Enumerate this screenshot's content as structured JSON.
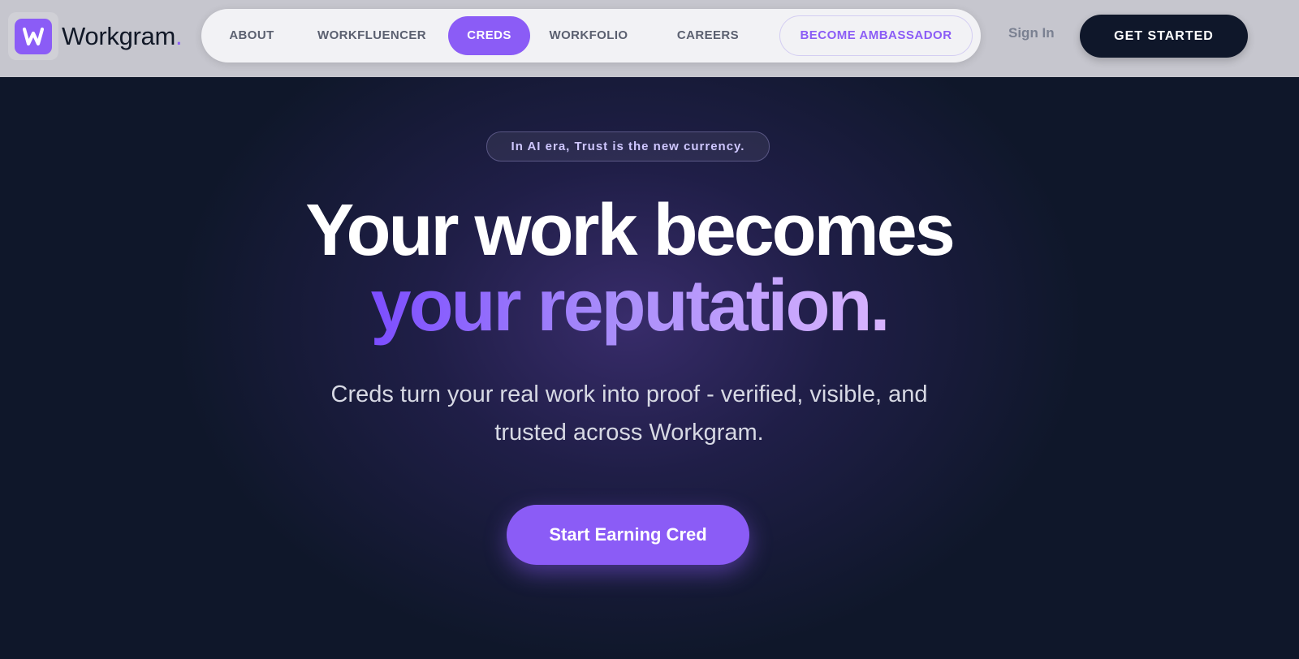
{
  "brand": {
    "name": "Workgram",
    "dot": ".",
    "logo_icon": "workgram-w-logo",
    "accent_color": "#8b5cf6"
  },
  "nav": {
    "items": [
      {
        "label": "ABOUT",
        "active": false
      },
      {
        "label": "WORKFLUENCER",
        "active": false
      },
      {
        "label": "CREDS",
        "active": true
      },
      {
        "label": "WORKFOLIO",
        "active": false
      },
      {
        "label": "CAREERS",
        "active": false
      }
    ],
    "ambassador_label": "BECOME AMBASSADOR"
  },
  "auth": {
    "sign_in_label": "Sign In",
    "get_started_label": "GET STARTED"
  },
  "hero": {
    "tagline": "In AI era, Trust is the new currency.",
    "headline_line1": "Your work becomes",
    "headline_line2": "your reputation.",
    "subtext_line1": "Creds turn your real work into proof - verified, visible, and",
    "subtext_line2": "trusted across Workgram.",
    "cta_label": "Start Earning Cred",
    "background_color": "#0f172a"
  }
}
